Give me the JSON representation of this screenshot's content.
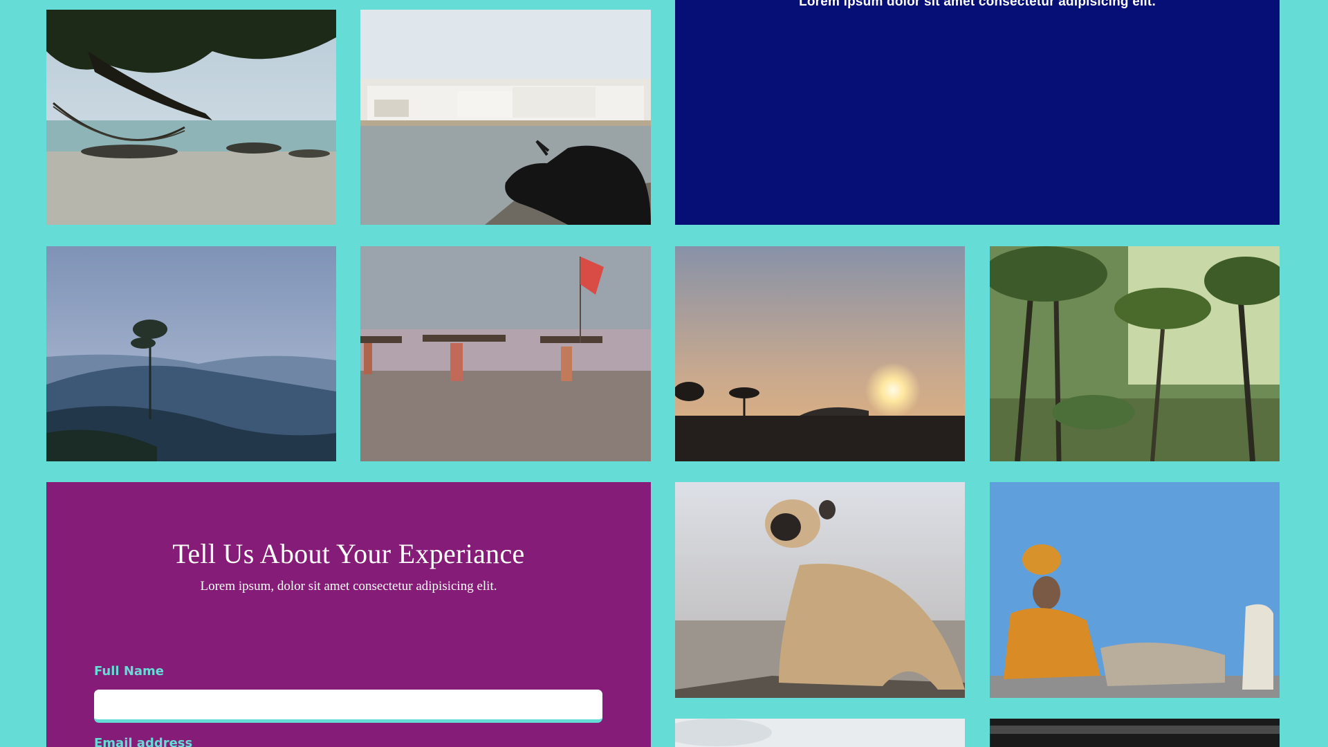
{
  "banner": {
    "text": "Lorem ipsum dolor sit amet consectetur adipisicing elit.",
    "background": "#050f76"
  },
  "form": {
    "title": "Tell Us About Your Experiance",
    "subtitle": "Lorem ipsum, dolor sit amet consectetur adipisicing elit.",
    "full_name_label": "Full Name",
    "full_name_value": "",
    "email_label": "Email address",
    "background": "#851c77",
    "accent": "#66dcd6"
  },
  "page": {
    "background": "#66dcd6"
  },
  "gallery": [
    {
      "name": "beach-hammock-photo"
    },
    {
      "name": "lake-cow-photo"
    },
    {
      "name": "misty-hills-photo"
    },
    {
      "name": "beach-carriers-photo"
    },
    {
      "name": "sunset-photo"
    },
    {
      "name": "palm-forest-photo"
    },
    {
      "name": "monkey-photo"
    },
    {
      "name": "sadhu-photo"
    },
    {
      "name": "sky-photo"
    },
    {
      "name": "dark-photo"
    }
  ]
}
